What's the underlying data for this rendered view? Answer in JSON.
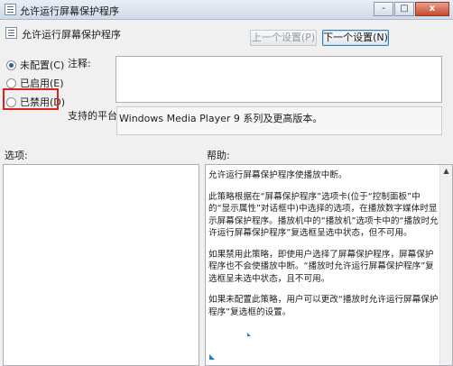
{
  "window": {
    "title": "允许运行屏幕保护程序",
    "controls": [
      "-",
      "□",
      "x"
    ]
  },
  "header": {
    "title": "允许运行屏幕保护程序",
    "prev_label": "上一个设置(P)",
    "next_label": "下一个设置(N)"
  },
  "state": {
    "options": [
      {
        "label": "未配置(C)",
        "checked": true
      },
      {
        "label": "已启用(E)",
        "checked": false
      },
      {
        "label": "已禁用(D)",
        "checked": false
      }
    ]
  },
  "comment": {
    "label": "注释:",
    "value": ""
  },
  "platform": {
    "label": "支持的平台:",
    "value": "Windows Media Player 9 系列及更高版本。"
  },
  "options_panel": {
    "label": "选项:"
  },
  "help_panel": {
    "label": "帮助:",
    "paragraphs": [
      "允许运行屏幕保护程序使播放中断。",
      "此策略根据在“屏幕保护程序”选项卡(位于“控制面板”中的“显示属性”对话框中)中选择的选项，在播放数字媒体时显示屏幕保护程序。播放机中的“播放机”选项卡中的“播放时允许运行屏幕保护程序”复选框呈选中状态，但不可用。",
      "如果禁用此策略，即使用户选择了屏幕保护程序，屏幕保护程序也不会使播放中断。“播放时允许运行屏幕保护程序”复选框呈未选中状态，且不可用。",
      "如果未配置此策略，用户可以更改“播放时允许运行屏幕保护程序”复选框的设置。"
    ]
  },
  "colors": {
    "highlight_border": "#e0211b",
    "accent": "#3c7fb1"
  }
}
